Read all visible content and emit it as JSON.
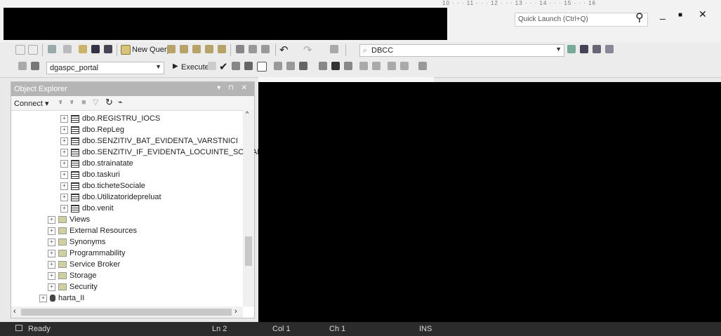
{
  "ruler": {
    "text": "10 · · · 11 · · · 12 · · · 13 · · · 14 · · · 15 · · · 16"
  },
  "quick_launch": {
    "placeholder": "Quick Launch (Ctrl+Q)"
  },
  "window_controls": {
    "minimize": "_",
    "maximize": "■",
    "close": "✕"
  },
  "toolbar": {
    "new_query_label": "New Query",
    "object_combo_value": "DBCC",
    "database_combo_value": "dgaspc_portal",
    "execute_label": "Execute"
  },
  "object_explorer": {
    "title": "Object Explorer",
    "title_buttons": "▾ ⊓ ✕",
    "connect_label": "Connect ▾",
    "tree": [
      {
        "label": "dbo.REGISTRU_IOCS",
        "kind": "table"
      },
      {
        "label": "dbo.RepLeg",
        "kind": "table"
      },
      {
        "label": "dbo.SENZITIV_BAT_EVIDENTA_VARSTNICI",
        "kind": "table"
      },
      {
        "label": "dbo.SENZITIV_IF_EVIDENTA_LOCUINTE_SOCIALI",
        "kind": "table"
      },
      {
        "label": "dbo.strainatate",
        "kind": "table"
      },
      {
        "label": "dbo.taskuri",
        "kind": "table"
      },
      {
        "label": "dbo.ticheteSociale",
        "kind": "table"
      },
      {
        "label": "dbo.Utilizatoridepreluat",
        "kind": "table"
      },
      {
        "label": "dbo.venit",
        "kind": "table"
      },
      {
        "label": "Views",
        "kind": "folder"
      },
      {
        "label": "External Resources",
        "kind": "folder"
      },
      {
        "label": "Synonyms",
        "kind": "folder"
      },
      {
        "label": "Programmability",
        "kind": "folder"
      },
      {
        "label": "Service Broker",
        "kind": "folder"
      },
      {
        "label": "Storage",
        "kind": "folder"
      },
      {
        "label": "Security",
        "kind": "folder"
      },
      {
        "label": "harta_II",
        "kind": "database"
      }
    ]
  },
  "status_bar": {
    "ready": "Ready",
    "line": "Ln 2",
    "col": "Col 1",
    "ch": "Ch 1",
    "mode": "INS"
  }
}
